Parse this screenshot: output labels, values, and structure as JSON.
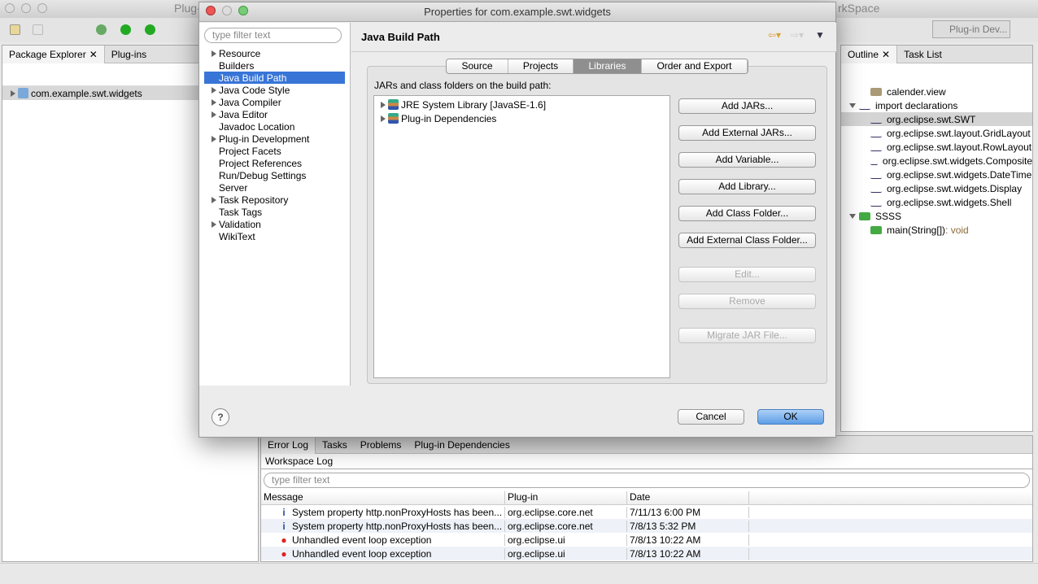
{
  "window": {
    "title_partial": "Plug-",
    "title_right": "rkSpace"
  },
  "perspective": {
    "label": "Plug-in Dev..."
  },
  "package_explorer": {
    "tabs": [
      "Package Explorer",
      "Plug-ins"
    ],
    "items": [
      "com.example.swt.widgets"
    ]
  },
  "outline": {
    "tabs": [
      "Outline",
      "Task List"
    ],
    "items": [
      {
        "label": "calender.view",
        "level": 1,
        "icon": "layout-icon"
      },
      {
        "label": "import declarations",
        "level": 0,
        "expanded": true,
        "icon": "imports-icon"
      },
      {
        "label": "org.eclipse.swt.SWT",
        "level": 1,
        "selected": true
      },
      {
        "label": "org.eclipse.swt.layout.GridLayout",
        "level": 1
      },
      {
        "label": "org.eclipse.swt.layout.RowLayout",
        "level": 1
      },
      {
        "label": "org.eclipse.swt.widgets.Composite",
        "level": 1
      },
      {
        "label": "org.eclipse.swt.widgets.DateTime",
        "level": 1
      },
      {
        "label": "org.eclipse.swt.widgets.Display",
        "level": 1
      },
      {
        "label": "org.eclipse.swt.widgets.Shell",
        "level": 1
      },
      {
        "label": "SSSS",
        "level": 0,
        "expanded": true,
        "icon": "class-icon"
      },
      {
        "label": "main(String[])",
        "suffix": " : void",
        "level": 1,
        "icon": "method-icon"
      }
    ]
  },
  "error_log": {
    "tabs": [
      "Error Log",
      "Tasks",
      "Problems",
      "Plug-in Dependencies"
    ],
    "title": "Workspace Log",
    "filter_placeholder": "type filter text",
    "columns": [
      "Message",
      "Plug-in",
      "Date"
    ],
    "rows": [
      {
        "type": "info",
        "message": "System property http.nonProxyHosts has been...",
        "plugin": "org.eclipse.core.net",
        "date": "7/11/13 6:00 PM"
      },
      {
        "type": "info",
        "message": "System property http.nonProxyHosts has been...",
        "plugin": "org.eclipse.core.net",
        "date": "7/8/13 5:32 PM"
      },
      {
        "type": "error",
        "message": "Unhandled event loop exception",
        "plugin": "org.eclipse.ui",
        "date": "7/8/13 10:22 AM"
      },
      {
        "type": "error",
        "message": "Unhandled event loop exception",
        "plugin": "org.eclipse.ui",
        "date": "7/8/13 10:22 AM"
      }
    ]
  },
  "dialog": {
    "title": "Properties for com.example.swt.widgets",
    "filter_placeholder": "type filter text",
    "nav": [
      {
        "label": "Resource",
        "expandable": true
      },
      {
        "label": "Builders"
      },
      {
        "label": "Java Build Path",
        "selected": true
      },
      {
        "label": "Java Code Style",
        "expandable": true
      },
      {
        "label": "Java Compiler",
        "expandable": true
      },
      {
        "label": "Java Editor",
        "expandable": true
      },
      {
        "label": "Javadoc Location"
      },
      {
        "label": "Plug-in Development",
        "expandable": true
      },
      {
        "label": "Project Facets"
      },
      {
        "label": "Project References"
      },
      {
        "label": "Run/Debug Settings"
      },
      {
        "label": "Server"
      },
      {
        "label": "Task Repository",
        "expandable": true
      },
      {
        "label": "Task Tags"
      },
      {
        "label": "Validation",
        "expandable": true
      },
      {
        "label": "WikiText"
      }
    ],
    "page_title": "Java Build Path",
    "tabs": [
      {
        "label": "Source"
      },
      {
        "label": "Projects"
      },
      {
        "label": "Libraries",
        "active": true
      },
      {
        "label": "Order and Export"
      }
    ],
    "list_label": "JARs and class folders on the build path:",
    "libraries": [
      "JRE System Library [JavaSE-1.6]",
      "Plug-in Dependencies"
    ],
    "buttons": [
      {
        "label": "Add JARs...",
        "enabled": true
      },
      {
        "label": "Add External JARs...",
        "enabled": true
      },
      {
        "label": "Add Variable...",
        "enabled": true
      },
      {
        "label": "Add Library...",
        "enabled": true
      },
      {
        "label": "Add Class Folder...",
        "enabled": true
      },
      {
        "label": "Add External Class Folder...",
        "enabled": true
      },
      {
        "label": "Edit...",
        "enabled": false
      },
      {
        "label": "Remove",
        "enabled": false
      },
      {
        "label": "Migrate JAR File...",
        "enabled": false
      }
    ],
    "cancel": "Cancel",
    "ok": "OK"
  },
  "colors": {
    "selection": "#3875d7",
    "ok_button": "#7fb3ef"
  }
}
